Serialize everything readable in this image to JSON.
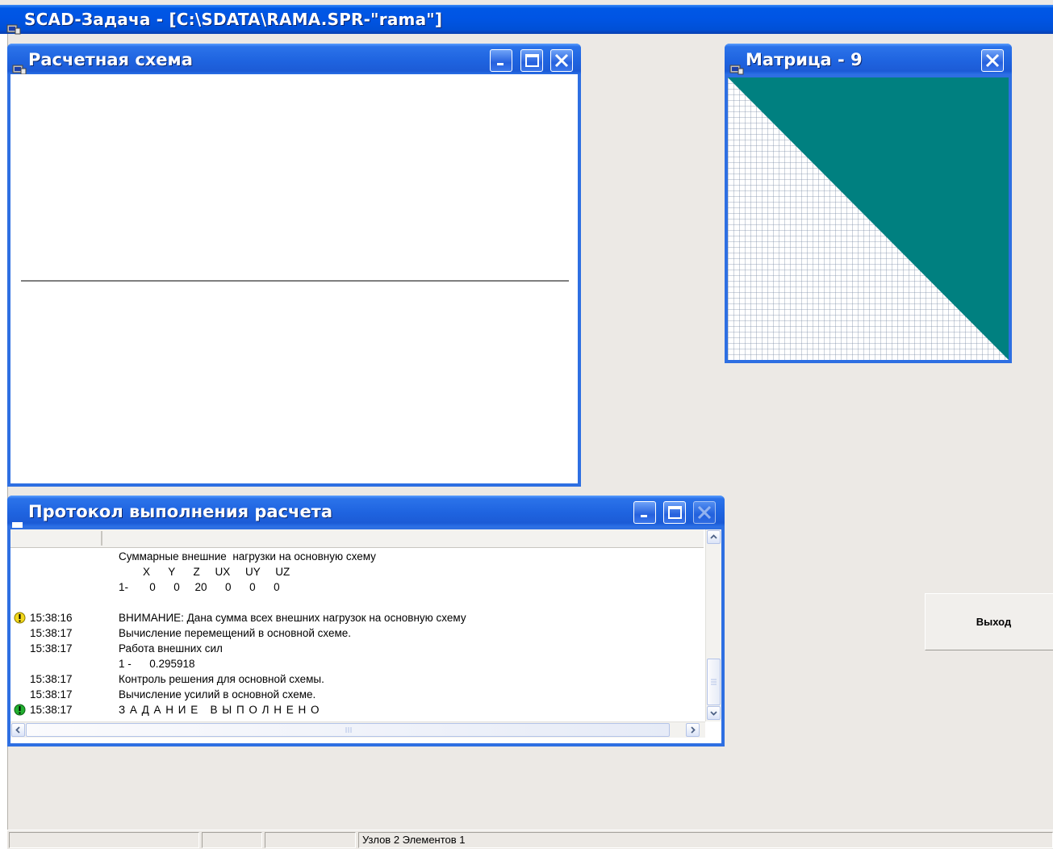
{
  "app": {
    "title": "SCAD-Задача - [C:\\SDATA\\RAMA.SPR-\"rama\"]"
  },
  "scheme_window": {
    "title": "Расчетная схема"
  },
  "matrix_window": {
    "title": "Матрица - 9"
  },
  "log_window": {
    "title": "Протокол выполнения расчета",
    "lines": [
      {
        "time": "",
        "text": "Суммарные внешние  нагрузки на основную схему",
        "icon": ""
      },
      {
        "time": "",
        "text": "        X      Y      Z     UX     UY     UZ",
        "icon": ""
      },
      {
        "time": "",
        "text": "1-       0      0     20      0      0      0",
        "icon": ""
      },
      {
        "time": "",
        "text": "",
        "icon": ""
      },
      {
        "time": "15:38:16",
        "text": "ВНИМАНИЕ: Дана сумма всех внешних нагрузок на основную схему",
        "icon": "warning"
      },
      {
        "time": "15:38:17",
        "text": "Вычисление перемещений в основной схеме.",
        "icon": ""
      },
      {
        "time": "15:38:17",
        "text": "Работа внешних сил",
        "icon": ""
      },
      {
        "time": "",
        "text": "1 -      0.295918",
        "icon": ""
      },
      {
        "time": "15:38:17",
        "text": "Контроль решения для основной схемы.",
        "icon": ""
      },
      {
        "time": "15:38:17",
        "text": "Вычисление усилий в основной схеме.",
        "icon": ""
      },
      {
        "time": "15:38:17",
        "text": "З А Д А Н И Е   В Ы П О Л Н Е Н О",
        "icon": "success"
      }
    ]
  },
  "exit_button": {
    "label": "Выход"
  },
  "status_bar": {
    "cells": [
      "",
      "",
      "",
      "Узлов 2 Элементов 1"
    ]
  },
  "colors": {
    "titlebar_blue": "#0054e3",
    "matrix_fill": "#008080",
    "warning": "#f3d81b",
    "success": "#22b030"
  }
}
